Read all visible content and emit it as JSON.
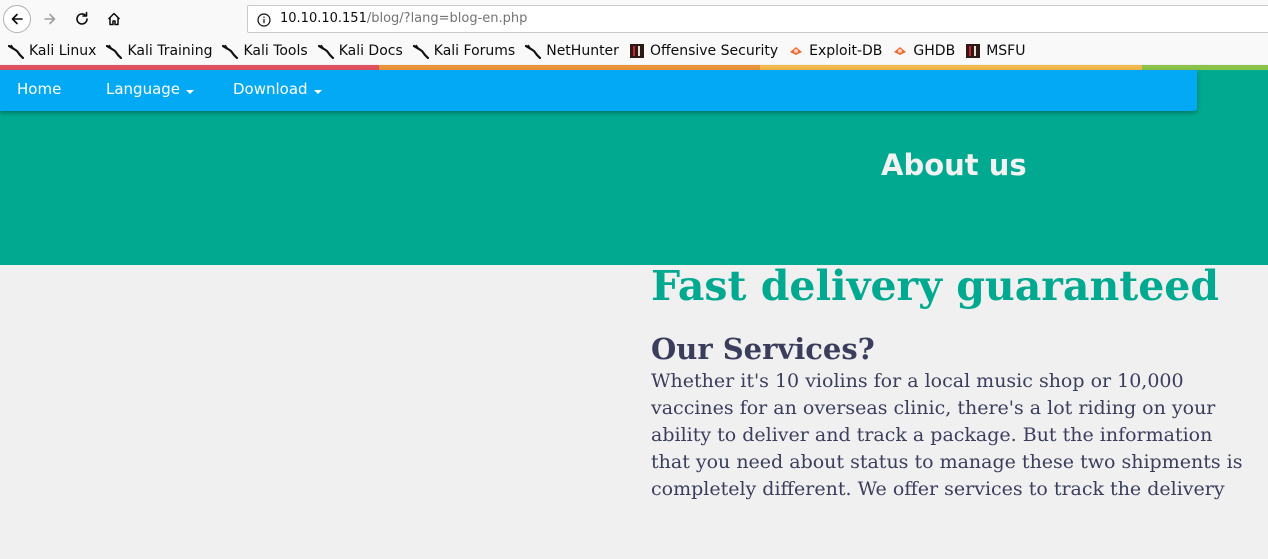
{
  "browser": {
    "url_host": "10.10.10.151",
    "url_path": "/blog/?lang=blog-en.php"
  },
  "bookmarks": [
    {
      "label": "Kali Linux",
      "icon": "kali-dragon-icon"
    },
    {
      "label": "Kali Training",
      "icon": "kali-dragon-icon"
    },
    {
      "label": "Kali Tools",
      "icon": "kali-dragon-icon"
    },
    {
      "label": "Kali Docs",
      "icon": "kali-dragon-icon"
    },
    {
      "label": "Kali Forums",
      "icon": "kali-dragon-icon"
    },
    {
      "label": "NetHunter",
      "icon": "kali-dragon-icon"
    },
    {
      "label": "Offensive Security",
      "icon": "offsec-icon"
    },
    {
      "label": "Exploit-DB",
      "icon": "exploit-db-icon"
    },
    {
      "label": "GHDB",
      "icon": "exploit-db-icon"
    },
    {
      "label": "MSFU",
      "icon": "offsec-icon"
    }
  ],
  "navbar": {
    "home": "Home",
    "language": "Language",
    "download": "Download"
  },
  "hero": {
    "title": "About us"
  },
  "main": {
    "headline": "Fast delivery guaranteed",
    "subhead": "Our Services?",
    "body": "Whether it's 10 violins for a local music shop or 10,000 vaccines for an overseas clinic, there's a lot riding on your ability to deliver and track a package. But the information that you need about status to manage these two shipments is completely different. We offer services to track the delivery"
  },
  "colors": {
    "hero_bg": "#00a98f",
    "navbar_bg": "#03a9f4",
    "headline": "#00a98f",
    "text": "#3a3d5c"
  }
}
